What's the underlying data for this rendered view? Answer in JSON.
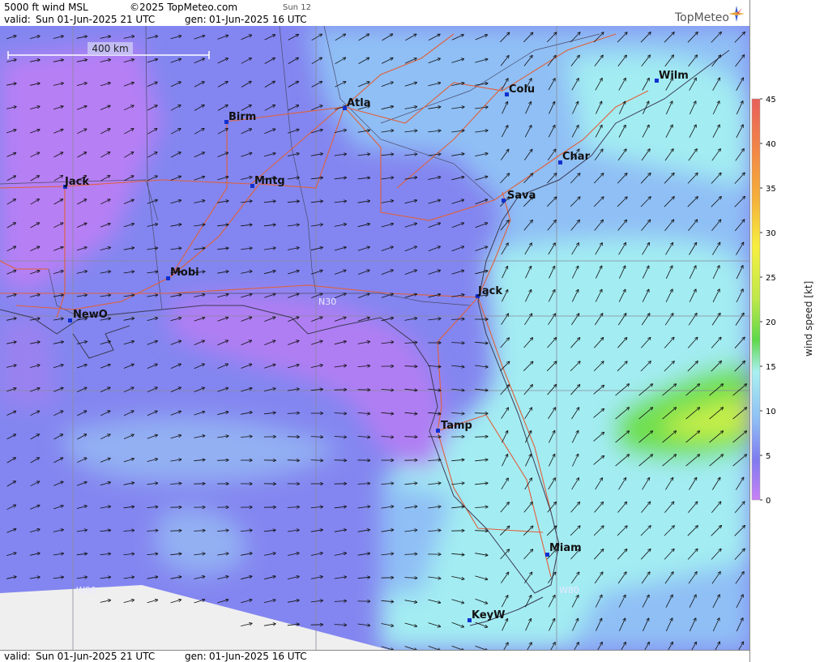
{
  "header": {
    "product": "5000 ft wind MSL",
    "copyright": "©2025 TopMeteo.com",
    "run_tag": "Sun 12",
    "valid_label": "valid:",
    "valid_value": "Sun  01-Jun-2025  21 UTC",
    "gen_label": "gen:",
    "gen_value": "01-Jun-2025 16 UTC"
  },
  "footer": {
    "valid_label": "valid:",
    "valid_value": "Sun  01-Jun-2025  21 UTC",
    "gen_label": "gen:",
    "gen_value": "01-Jun-2025 16 UTC"
  },
  "logo": {
    "text": "TopMeteo"
  },
  "scale_bar": {
    "label": "400 km"
  },
  "map": {
    "cities": [
      {
        "name": "Birm"
      },
      {
        "name": "Atla"
      },
      {
        "name": "Colu"
      },
      {
        "name": "Wilm"
      },
      {
        "name": "Char"
      },
      {
        "name": "Jack"
      },
      {
        "name": "Mntg"
      },
      {
        "name": "Sava"
      },
      {
        "name": "Mobi"
      },
      {
        "name": "Jack"
      },
      {
        "name": "NewO"
      },
      {
        "name": "Tamp"
      },
      {
        "name": "Miam"
      },
      {
        "name": "KeyW"
      }
    ],
    "grid_labels": {
      "n30": "N30",
      "w90": "W90",
      "w80": "W80"
    },
    "wind_direction": "southwest-to-northeast"
  },
  "legend": {
    "title": "wind speed [kt]",
    "ticks": [
      "45",
      "40",
      "35",
      "30",
      "25",
      "20",
      "15",
      "10",
      "5",
      "0"
    ],
    "colors": [
      "#e8605a",
      "#f28a45",
      "#f5b13a",
      "#f6ef40",
      "#bde84a",
      "#5fd84a",
      "#a8f0f0",
      "#8fbff5",
      "#7f7cef",
      "#c880f5"
    ]
  }
}
